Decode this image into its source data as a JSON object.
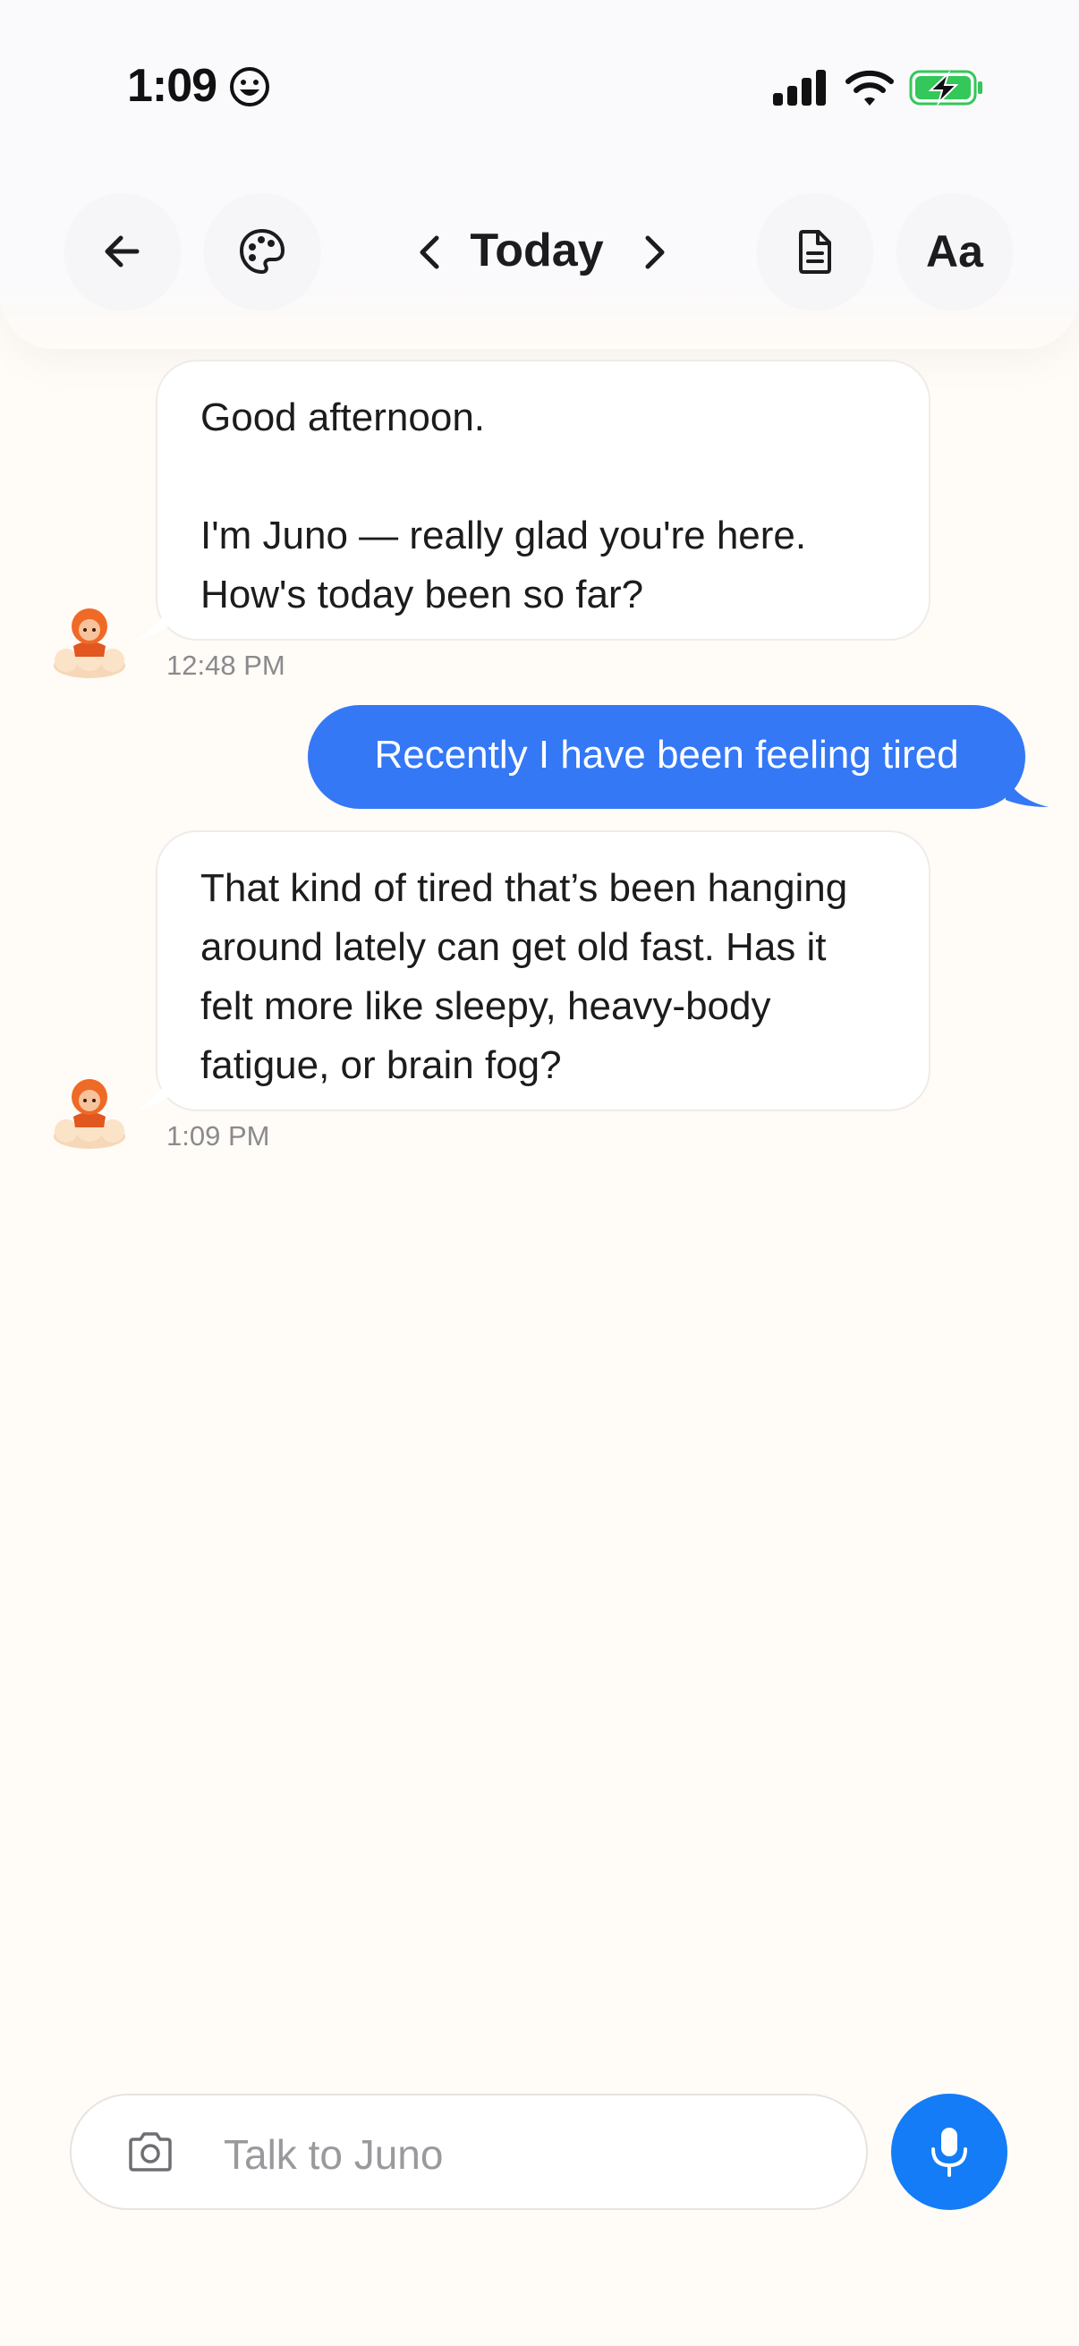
{
  "status_bar": {
    "time": "1:09",
    "emoji_icon": "smiley-face-icon",
    "icons": [
      "cellular-signal-icon",
      "wifi-icon",
      "battery-charging-icon"
    ],
    "battery_color": "#34c759"
  },
  "header": {
    "back_icon": "arrow-left-icon",
    "theme_icon": "palette-icon",
    "date_label": "Today",
    "prev_icon": "chevron-left-icon",
    "next_icon": "chevron-right-icon",
    "doc_icon": "document-icon",
    "font_label": "Aa"
  },
  "messages": [
    {
      "sender": "assistant",
      "text": "Good afternoon.\n\nI'm Juno — really glad you're here. How's today been so far?",
      "time": "12:48 PM"
    },
    {
      "sender": "user",
      "text": "Recently I have been feeling tired"
    },
    {
      "sender": "assistant",
      "text": "That kind of tired that’s been hanging around lately can get old fast. Has it felt more like sleepy, heavy-body fatigue, or brain fog?",
      "time": "1:09 PM"
    }
  ],
  "composer": {
    "placeholder": "Talk to Juno",
    "value": "",
    "camera_icon": "camera-icon",
    "mic_icon": "microphone-icon"
  },
  "colors": {
    "background": "#fffbf6",
    "user_bubble": "#3478f6",
    "mic_button": "#137cf6"
  }
}
